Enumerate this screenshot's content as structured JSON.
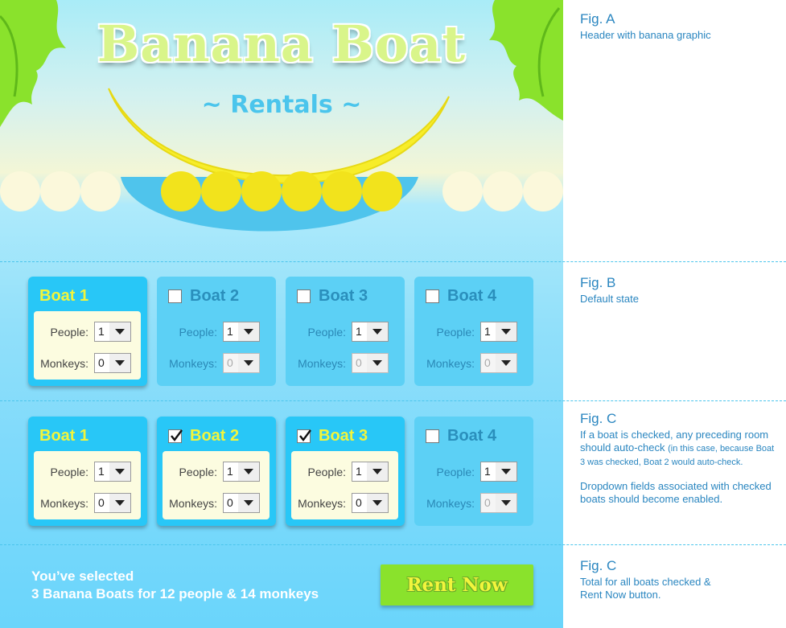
{
  "header": {
    "title": "Banana Boat",
    "subtitle": "~ Rentals ~"
  },
  "colors": {
    "card_active": "#28c7f7",
    "card_inactive": "#5cd0f5",
    "title_active": "#f2f53c",
    "title_inactive": "#2a8fbc",
    "rent_button": "#8ae22c",
    "annotation": "#2a86c0"
  },
  "labels": {
    "people": "People:",
    "monkeys": "Monkeys:"
  },
  "figB": {
    "boats": [
      {
        "name": "Boat 1",
        "checked": null,
        "active": true,
        "people": "1",
        "monkeys": "0"
      },
      {
        "name": "Boat 2",
        "checked": false,
        "active": false,
        "people": "1",
        "monkeys": "0"
      },
      {
        "name": "Boat 3",
        "checked": false,
        "active": false,
        "people": "1",
        "monkeys": "0"
      },
      {
        "name": "Boat 4",
        "checked": false,
        "active": false,
        "people": "1",
        "monkeys": "0"
      }
    ]
  },
  "figC": {
    "boats": [
      {
        "name": "Boat 1",
        "checked": null,
        "active": true,
        "people": "1",
        "monkeys": "0"
      },
      {
        "name": "Boat 2",
        "checked": true,
        "active": true,
        "people": "1",
        "monkeys": "0"
      },
      {
        "name": "Boat 3",
        "checked": true,
        "active": true,
        "people": "1",
        "monkeys": "0"
      },
      {
        "name": "Boat 4",
        "checked": false,
        "active": false,
        "people": "1",
        "monkeys": "0"
      }
    ]
  },
  "summary": {
    "line1": "You’ve selected",
    "line2": "3 Banana Boats for 12 people & 14 monkeys"
  },
  "rent_label": "Rent Now",
  "annotations": {
    "a": {
      "title": "Fig. A",
      "text": "Header with banana graphic"
    },
    "b": {
      "title": "Fig. B",
      "text": "Default state"
    },
    "c1": {
      "title": "Fig. C",
      "text_main": "If a boat is checked, any preceding room should auto-check",
      "text_small": "(in this case, because Boat 3 was checked, Boat 2 would auto-check.",
      "text2": "Dropdown fields associated with checked boats should become enabled."
    },
    "c2": {
      "title": "Fig. C",
      "text": "Total for all boats checked & Rent Now button."
    }
  }
}
